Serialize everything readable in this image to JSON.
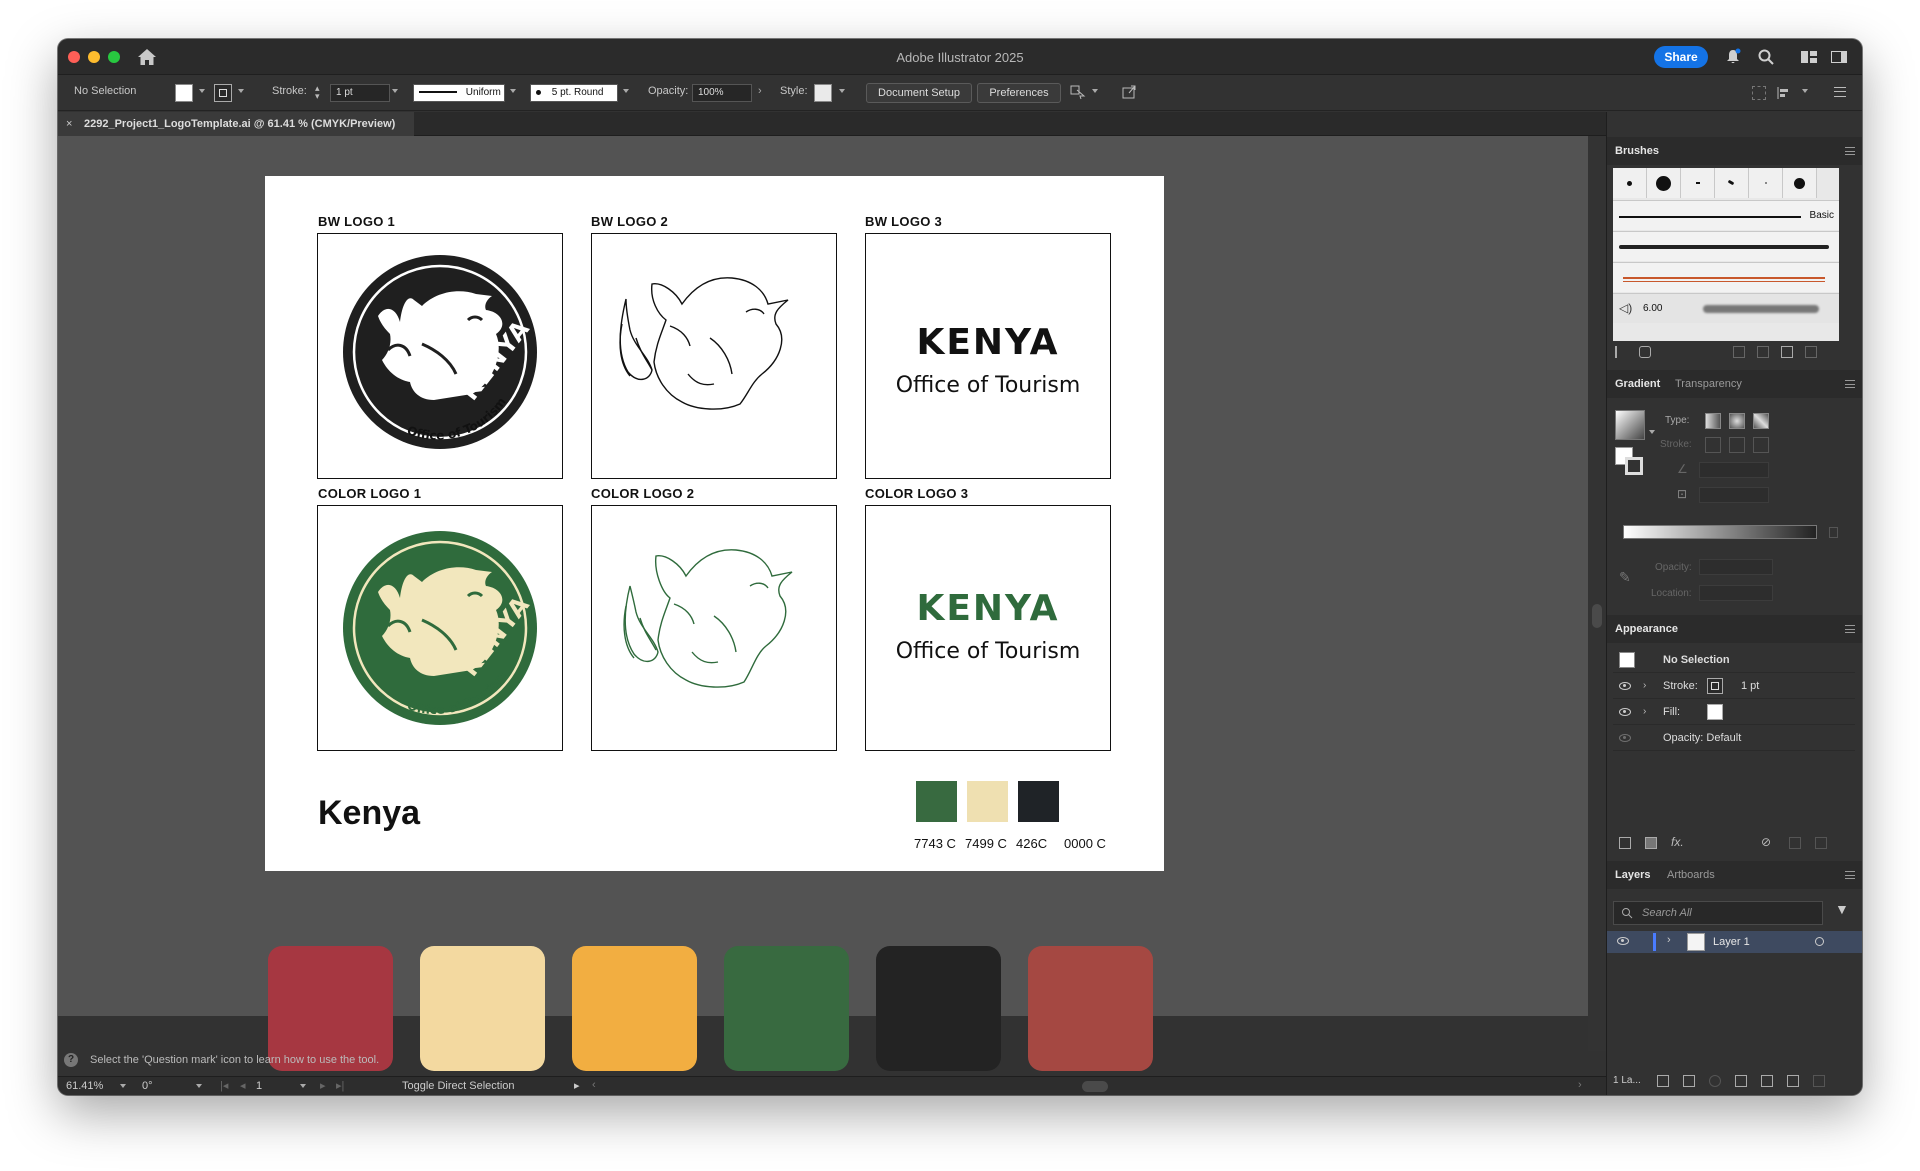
{
  "window": {
    "title": "Adobe Illustrator 2025",
    "share_label": "Share",
    "traffic_colors": [
      "#ff5f57",
      "#febc2e",
      "#28c840"
    ]
  },
  "control_bar": {
    "selection": "No Selection",
    "stroke_label": "Stroke:",
    "stroke_value": "1 pt",
    "stroke_profile": "Uniform",
    "brush": "5 pt. Round",
    "opacity_label": "Opacity:",
    "opacity_value": "100%",
    "style_label": "Style:",
    "document_setup": "Document Setup",
    "preferences": "Preferences"
  },
  "document_tab": {
    "name": "2292_Project1_LogoTemplate.ai @ 61.41 % (CMYK/Preview)"
  },
  "artboard": {
    "labels": {
      "bw1": "BW LOGO 1",
      "bw2": "BW LOGO 2",
      "bw3": "BW LOGO 3",
      "c1": "COLOR LOGO 1",
      "c2": "COLOR LOGO 2",
      "c3": "COLOR LOGO 3"
    },
    "logo_word": "KENYA",
    "logo_tagline": "Office of Tourism",
    "badge_tagline": "Office of Tourism",
    "footer_title": "Kenya",
    "pantone": [
      {
        "name": "7743 C",
        "color": "#386a40"
      },
      {
        "name": "7499 C",
        "color": "#efe0b1"
      },
      {
        "name": "426C",
        "color": "#1f2327"
      },
      {
        "name": "0000 C",
        "color": "#ffffff"
      }
    ],
    "green": "#2f6b3c",
    "cream": "#f2e7bd"
  },
  "canvas_swatches": [
    "#a63741",
    "#f3d9a0",
    "#f2ae41",
    "#386a40",
    "#232323",
    "#a54842"
  ],
  "hint": "Select the 'Question mark' icon to learn how to use the tool.",
  "status": {
    "zoom": "61.41%",
    "rotation": "0°",
    "artboard_num": "1",
    "tool": "Toggle Direct Selection"
  },
  "panels": {
    "brushes": {
      "title": "Brushes",
      "basic": "Basic",
      "size": "6.00"
    },
    "gradient": {
      "tab1": "Gradient",
      "tab2": "Transparency",
      "type_label": "Type:",
      "stroke_label": "Stroke:",
      "opacity_label": "Opacity:",
      "location_label": "Location:"
    },
    "appearance": {
      "title": "Appearance",
      "selection": "No Selection",
      "stroke": "Stroke:",
      "stroke_value": "1 pt",
      "fill": "Fill:",
      "opacity": "Opacity: Default"
    },
    "layers": {
      "tab1": "Layers",
      "tab2": "Artboards",
      "search_placeholder": "Search All",
      "layer_name": "Layer 1",
      "footer": "1 La..."
    }
  }
}
